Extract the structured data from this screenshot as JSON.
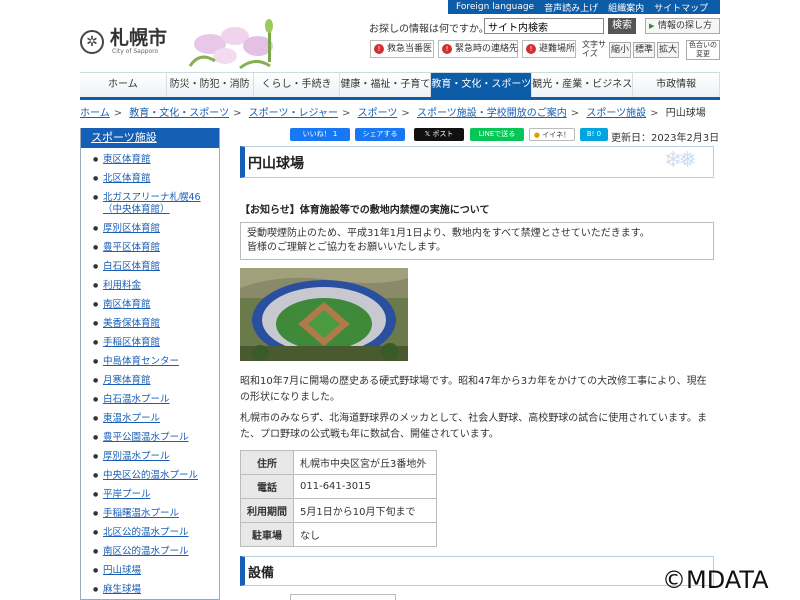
{
  "topbar": {
    "items": [
      "Foreign language",
      "音声読み上げ",
      "組織案内",
      "サイトマップ"
    ]
  },
  "logo": {
    "name": "札幌市",
    "sub": "City of Sapporo"
  },
  "search": {
    "question": "お探しの情報は何ですか。",
    "value": "サイト内検索",
    "button": "検索",
    "info_button": "情報の探し方"
  },
  "emergency": [
    {
      "label": "救急当番医"
    },
    {
      "label": "緊急時の連絡先"
    },
    {
      "label": "避難場所"
    }
  ],
  "fontsize": {
    "label": "文字サイズ",
    "small": "縮小",
    "standard": "標準",
    "large": "拡大",
    "color": "色合いの変更"
  },
  "gnav": [
    "ホーム",
    "防災・防犯・消防",
    "くらし・手続き",
    "健康・福祉・子育て",
    "教育・文化・スポーツ",
    "観光・産業・ビジネス",
    "市政情報"
  ],
  "breadcrumb": [
    "ホーム",
    "教育・文化・スポーツ",
    "スポーツ・レジャー",
    "スポーツ",
    "スポーツ施設・学校開放のご案内",
    "スポーツ施設"
  ],
  "breadcrumb_current": "円山球場",
  "sidebar": {
    "title": "スポーツ施設",
    "items": [
      "東区体育館",
      "北区体育館",
      "北ガスアリーナ札幌46（中央体育館）",
      "厚別区体育館",
      "豊平区体育館",
      "白石区体育館",
      "利用料金",
      "南区体育館",
      "美香保体育館",
      "手稲区体育館",
      "中島体育センター",
      "月寒体育館",
      "白石温水プール",
      "東温水プール",
      "豊平公園温水プール",
      "厚別温水プール",
      "中央区公的温水プール",
      "平岸プール",
      "手稲曙温水プール",
      "北区公的温水プール",
      "南区公的温水プール",
      "円山球場",
      "麻生球場"
    ]
  },
  "social": {
    "like": "いいね！ 1",
    "share": "シェアする",
    "post": "ポスト",
    "line": "LINEで送る",
    "iine": "イイネ！",
    "hatena": "B! 0"
  },
  "updated": "更新日：2023年2月3日",
  "page_title": "円山球場",
  "notice_heading": "【お知らせ】体育施設等での敷地内禁煙の実施について",
  "notice_lines": [
    "受動喫煙防止のため、平成31年1月1日より、敷地内をすべて禁煙とさせていただきます。",
    "皆様のご理解とご協力をお願いいたします。"
  ],
  "description1": "昭和10年7月に開場の歴史ある硬式野球場です。昭和47年から3カ年をかけての大改修工事により、現在の形状になりました。",
  "description2": "札幌市のみならず、北海道野球界のメッカとして、社会人野球、高校野球の試合に使用されています。また、プロ野球の公式戦も年に数試合、開催されています。",
  "info": [
    {
      "label": "住所",
      "value": "札幌市中央区宮が丘3番地外"
    },
    {
      "label": "電話",
      "value": "011-641-3015"
    },
    {
      "label": "利用期間",
      "value": "5月1日から10月下旬まで"
    },
    {
      "label": "駐車場",
      "value": "なし"
    }
  ],
  "facility_heading": "設備",
  "watermark": "©MDATA",
  "colors": {
    "brand": "#0d5ca8",
    "emergency": "#d32f2f"
  }
}
